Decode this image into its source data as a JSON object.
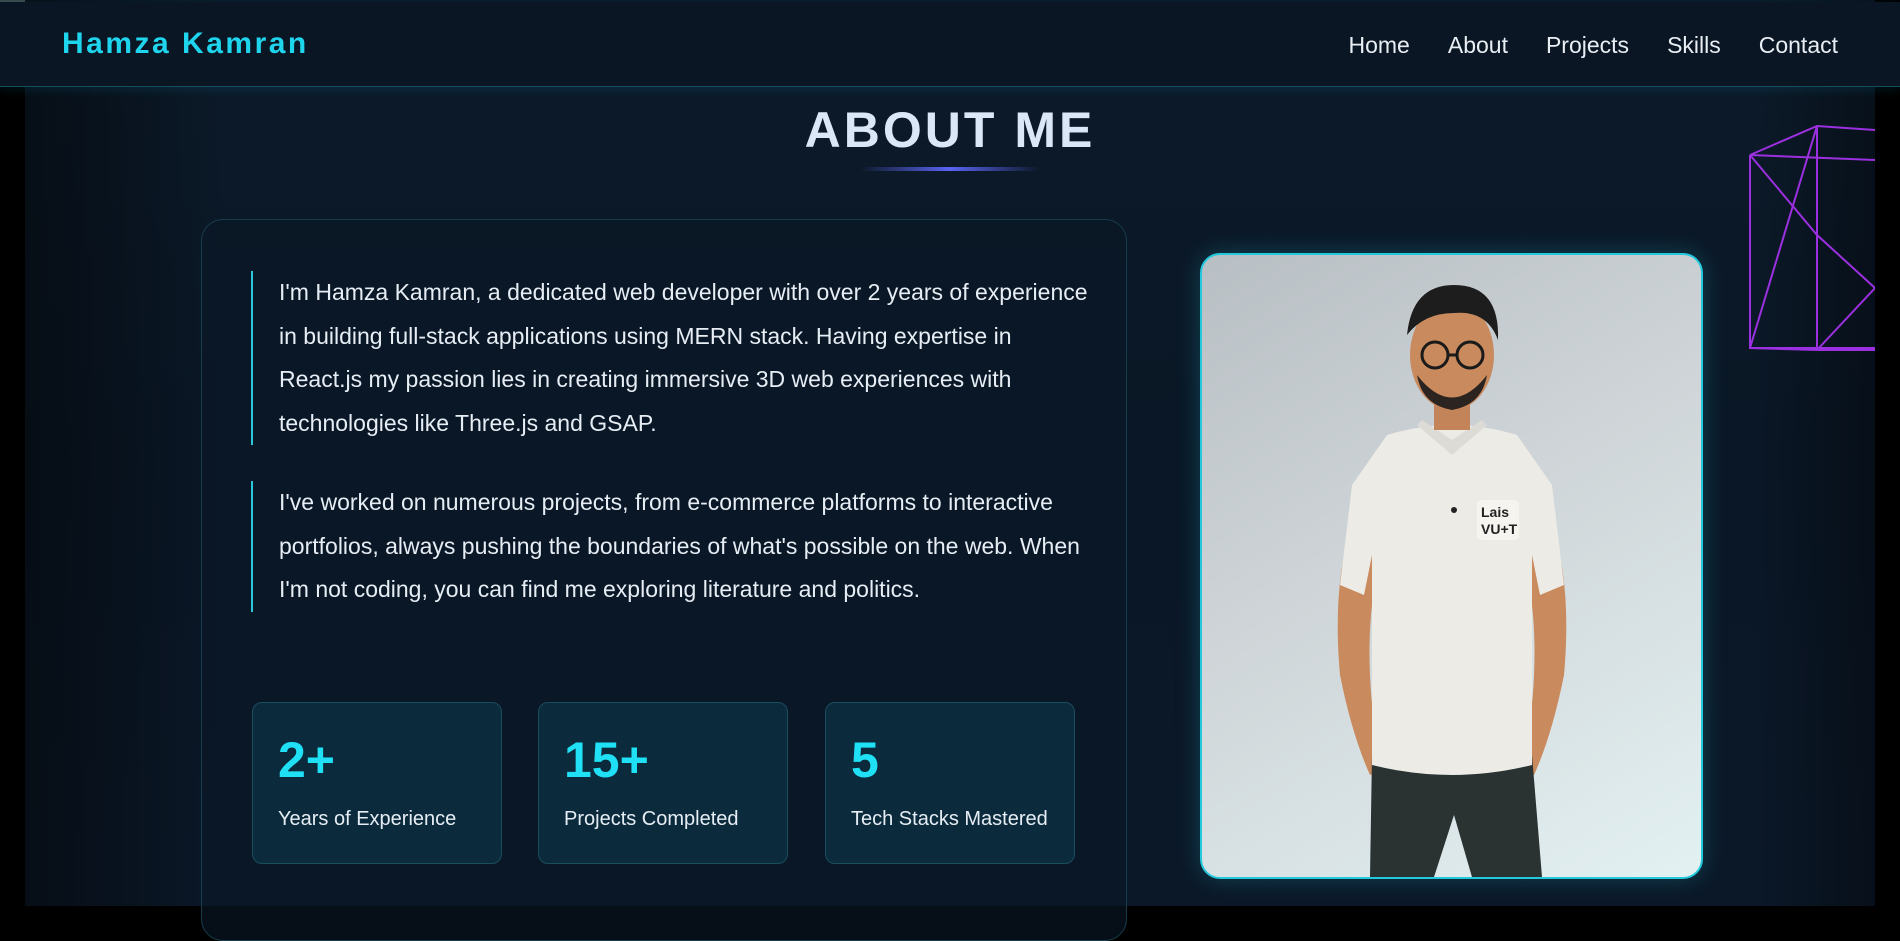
{
  "header": {
    "brand": "Hamza Kamran",
    "nav": [
      "Home",
      "About",
      "Projects",
      "Skills",
      "Contact"
    ]
  },
  "about": {
    "title": "ABOUT ME",
    "paragraphs": [
      "I'm Hamza Kamran, a dedicated web developer with over 2 years of experience in building full-stack applications using MERN stack. Having expertise in React.js my passion lies in creating immersive 3D web experiences with technologies like Three.js and GSAP.",
      "I've worked on numerous projects, from e-commerce platforms to interactive portfolios, always pushing the boundaries of what's possible on the web. When I'm not coding, you can find me exploring literature and politics."
    ],
    "stats": [
      {
        "value": "2+",
        "label": "Years of Experience"
      },
      {
        "value": "15+",
        "label": "Projects Completed"
      },
      {
        "value": "5",
        "label": "Tech Stacks Mastered"
      }
    ]
  },
  "colors": {
    "accent": "#1fd5ee",
    "background": "#0b1828",
    "wireframe": "#9b30e0"
  }
}
